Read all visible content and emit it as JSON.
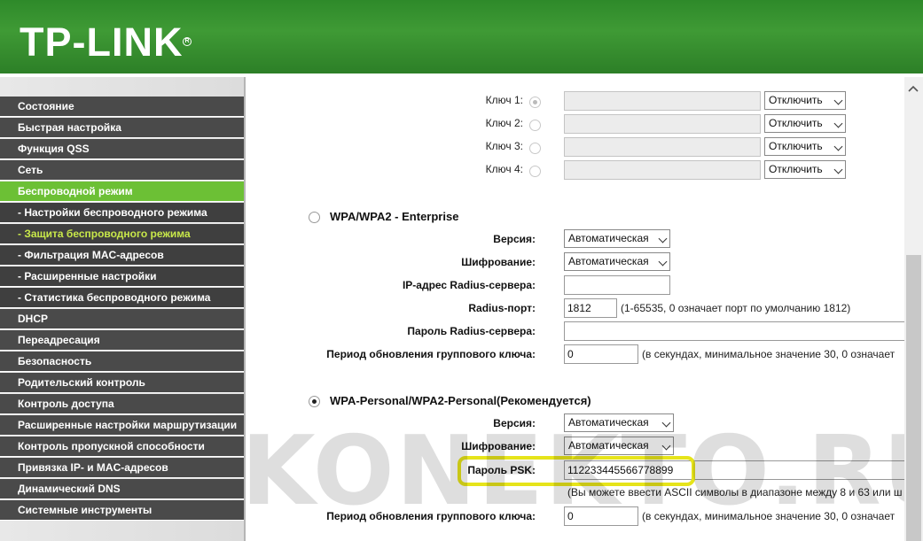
{
  "brand": {
    "logo": "TP-LINK",
    "reg_mark": "R"
  },
  "sidebar": {
    "items": [
      {
        "label": "Состояние"
      },
      {
        "label": "Быстрая настройка"
      },
      {
        "label": "Функция QSS"
      },
      {
        "label": "Сеть"
      },
      {
        "label": "Беспроводной режим"
      },
      {
        "label": "- Настройки беспроводного режима"
      },
      {
        "label": "- Защита беспроводного режима"
      },
      {
        "label": "- Фильтрация MAC-адресов"
      },
      {
        "label": "- Расширенные настройки"
      },
      {
        "label": "- Статистика беспроводного режима"
      },
      {
        "label": "DHCP"
      },
      {
        "label": "Переадресация"
      },
      {
        "label": "Безопасность"
      },
      {
        "label": "Родительский контроль"
      },
      {
        "label": "Контроль доступа"
      },
      {
        "label": "Расширенные настройки маршрутизации"
      },
      {
        "label": "Контроль пропускной способности"
      },
      {
        "label": "Привязка IP- и MAC-адресов"
      },
      {
        "label": "Динамический DNS"
      },
      {
        "label": "Системные инструменты"
      }
    ]
  },
  "wep": {
    "keys": [
      {
        "label": "Ключ 1:",
        "type": "Отключить"
      },
      {
        "label": "Ключ 2:",
        "type": "Отключить"
      },
      {
        "label": "Ключ 3:",
        "type": "Отключить"
      },
      {
        "label": "Ключ 4:",
        "type": "Отключить"
      }
    ]
  },
  "enterprise": {
    "title": "WPA/WPA2 - Enterprise",
    "version_label": "Версия:",
    "version_value": "Автоматическая",
    "encryption_label": "Шифрование:",
    "encryption_value": "Автоматическая",
    "radius_ip_label": "IP-адрес Radius-сервера:",
    "radius_ip_value": "",
    "radius_port_label": "Radius-порт:",
    "radius_port_value": "1812",
    "radius_port_note": "(1-65535, 0 означает порт по умолчанию 1812)",
    "radius_password_label": "Пароль Radius-сервера:",
    "radius_password_value": "",
    "group_key_label": "Период обновления группового ключа:",
    "group_key_value": "0",
    "group_key_note": "(в секундах, минимальное значение 30, 0 означает"
  },
  "personal": {
    "title": "WPA-Personal/WPA2-Personal(Рекомендуется)",
    "version_label": "Версия:",
    "version_value": "Автоматическая",
    "encryption_label": "Шифрование:",
    "encryption_value": "Автоматическая",
    "psk_label": "Пароль PSK:",
    "psk_value": "112233445566778899",
    "psk_note": "(Вы можете ввести ASCII символы в диапазоне между 8 и 63 или ш",
    "group_key_label": "Период обновления группового ключа:",
    "group_key_value": "0",
    "group_key_note": "(в секундах, минимальное значение 30, 0 означает"
  },
  "watermark": "KONEKTO.RU",
  "colors": {
    "header": "#3a9430",
    "active": "#6cc035",
    "highlight": "#e6e41a"
  }
}
